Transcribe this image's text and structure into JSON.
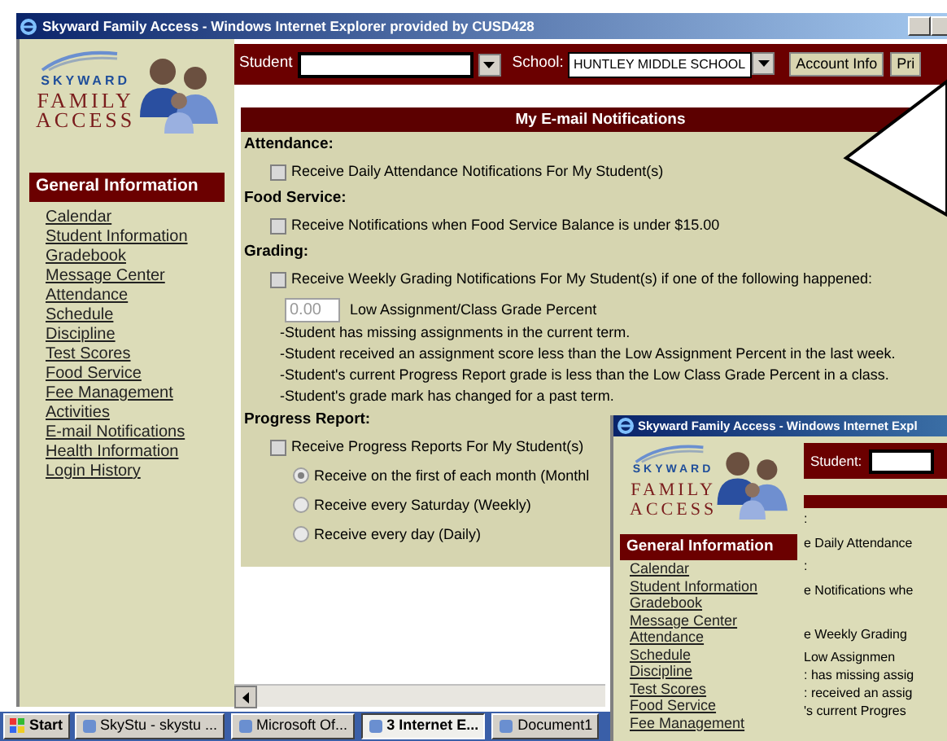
{
  "window": {
    "title": "Skyward Family Access - Windows Internet Explorer provided by CUSD428"
  },
  "logo": {
    "brand": "SKYWARD",
    "line1": "FAMILY",
    "line2": "ACCESS"
  },
  "sidebar": {
    "heading": "General Information",
    "items": [
      "Calendar",
      "Student Information",
      "Gradebook",
      "Message Center",
      "Attendance",
      "Schedule",
      "Discipline",
      "Test Scores",
      "Food Service",
      "Fee Management",
      "Activities",
      "E-mail Notifications",
      "Health Information",
      "Login History"
    ]
  },
  "header": {
    "student_label": "Student",
    "school_label": "School:",
    "school_value": "HUNTLEY MIDDLE SCHOOL",
    "buttons": [
      "Account Info",
      "Pri"
    ]
  },
  "panel": {
    "title": "My E-mail Notifications",
    "sections": [
      {
        "heading": "Attendance:",
        "options": [
          {
            "kind": "checkbox",
            "label": "Receive Daily Attendance Notifications For My Student(s)",
            "checked": false
          }
        ]
      },
      {
        "heading": "Food Service:",
        "options": [
          {
            "kind": "checkbox",
            "label": "Receive Notifications when Food Service Balance is under $15.00",
            "checked": false
          }
        ]
      },
      {
        "heading": "Grading:",
        "options": [
          {
            "kind": "checkbox",
            "label": "Receive Weekly Grading Notifications For My Student(s) if one of the following happened:",
            "checked": false
          },
          {
            "kind": "percent",
            "value": "0.00",
            "label": "Low Assignment/Class Grade Percent"
          },
          {
            "kind": "note",
            "label": "-Student has missing assignments in the current term."
          },
          {
            "kind": "note",
            "label": "-Student received an assignment score less than the Low Assignment Percent in the last week."
          },
          {
            "kind": "note",
            "label": "-Student's current Progress Report grade is less than the Low Class Grade Percent in a class."
          },
          {
            "kind": "note",
            "label": "-Student's grade mark has changed for a past term."
          }
        ]
      },
      {
        "heading": "Progress Report:",
        "options": [
          {
            "kind": "checkbox",
            "label": "Receive Progress Reports For My Student(s)",
            "checked": false
          },
          {
            "kind": "radio",
            "label": "Receive on the first of each month (Monthl",
            "selected": true
          },
          {
            "kind": "radio",
            "label": "Receive every Saturday (Weekly)",
            "selected": false
          },
          {
            "kind": "radio",
            "label": "Receive every day (Daily)",
            "selected": false
          }
        ]
      }
    ]
  },
  "second_window": {
    "title": "Skyward Family Access - Windows Internet Expl",
    "logo": {
      "brand": "SKYWARD",
      "line1": "FAMILY",
      "line2": "ACCESS"
    },
    "student_label": "Student:",
    "sidebar_heading": "General Information",
    "sidebar_items": [
      "Calendar",
      "Student Information",
      "Gradebook",
      "Message Center",
      "Attendance",
      "Schedule",
      "Discipline",
      "Test Scores",
      "Food Service",
      "Fee Management"
    ],
    "fragments": [
      ":",
      "e Daily Attendance",
      ":",
      "e Notifications whe",
      "e Weekly Grading",
      "Low Assignmen",
      ": has missing assig",
      ": received an assig",
      "'s current Progres"
    ]
  },
  "taskbar": {
    "start": "Start",
    "items": [
      {
        "label": "SkyStu - skystu ...",
        "selected": false
      },
      {
        "label": "Microsoft Of...",
        "selected": false
      },
      {
        "label": "3 Internet E...",
        "selected": true
      },
      {
        "label": "Document1",
        "selected": false
      }
    ]
  }
}
